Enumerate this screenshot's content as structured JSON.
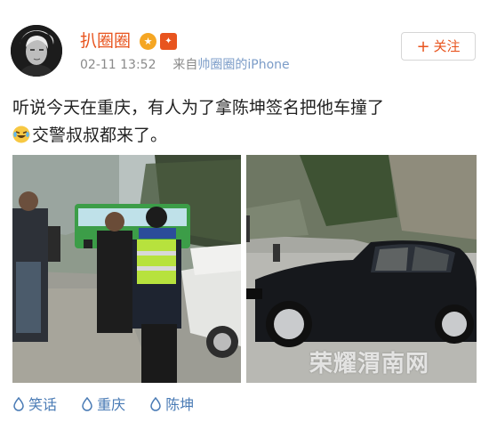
{
  "user": {
    "name": "扒圈圈",
    "badge_gold_icon": "crown-badge",
    "badge_red_icon": "vip-badge",
    "time": "02-11 13:52",
    "source_prefix": "来自",
    "source": "帅圈圈的iPhone"
  },
  "follow": {
    "label": "关注",
    "plus": "+"
  },
  "post": {
    "line1": "听说今天在重庆，有人为了拿陈坤签名把他车撞了",
    "line2": "交警叔叔都来了。",
    "emoji": "laughing-tears-emoji"
  },
  "watermark": "荣耀渭南网",
  "tags": [
    {
      "label": "笑话"
    },
    {
      "label": "重庆"
    },
    {
      "label": "陈坤"
    }
  ],
  "colors": {
    "username": "#e8541e",
    "link": "#4a7bb5",
    "meta": "#8a8a8a"
  }
}
